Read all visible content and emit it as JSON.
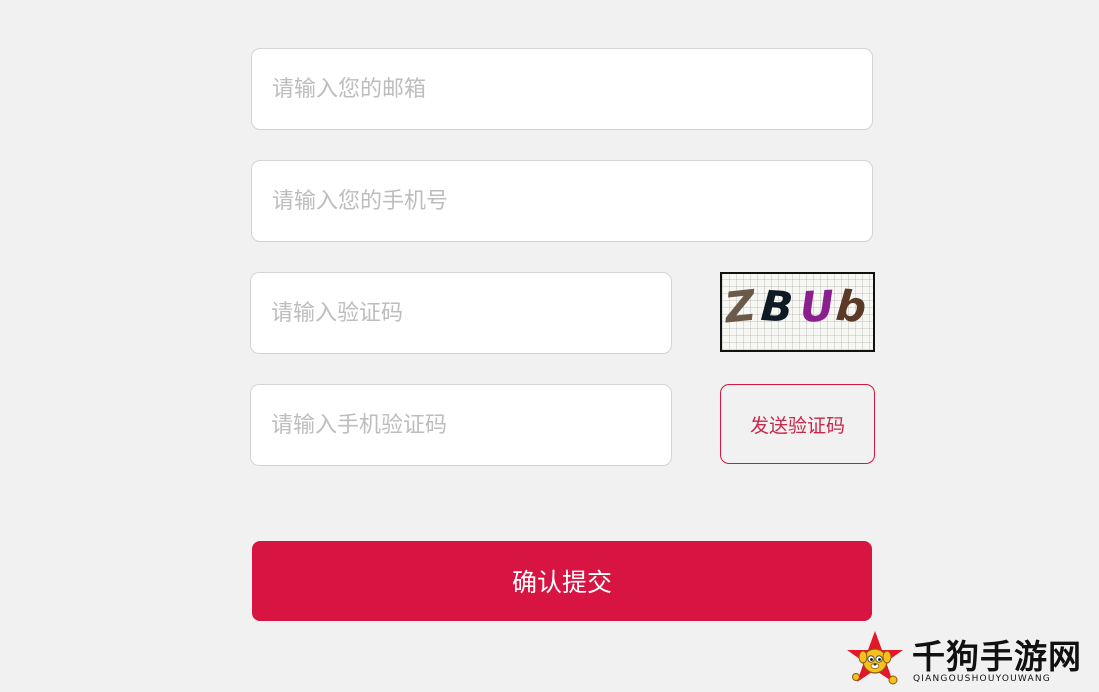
{
  "form": {
    "email": {
      "placeholder": "请输入您的邮箱",
      "value": ""
    },
    "phone": {
      "placeholder": "请输入您的手机号",
      "value": ""
    },
    "captcha": {
      "placeholder": "请输入验证码",
      "value": ""
    },
    "sms_code": {
      "placeholder": "请输入手机验证码",
      "value": ""
    },
    "captcha_image": {
      "chars": [
        {
          "char": "Z",
          "color": "#6b5a48"
        },
        {
          "char": "B",
          "color": "#0f1a24"
        },
        {
          "char": "U",
          "color": "#8a1f8e"
        },
        {
          "char": "b",
          "color": "#5a3a26"
        }
      ]
    },
    "send_code_label": "发送验证码",
    "submit_label": "确认提交"
  },
  "colors": {
    "background": "#f2f1f1",
    "accent": "#d81442",
    "send_code_text": "#c8284a"
  },
  "watermark": {
    "brand": "千狗手游网",
    "sub": "QIANGOUSHOUYOUWANG"
  }
}
